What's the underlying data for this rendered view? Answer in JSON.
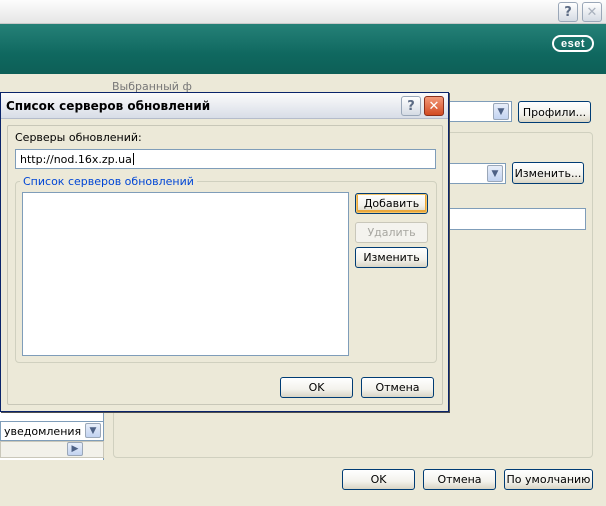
{
  "window": {
    "help_glyph": "?",
    "close_glyph": "✕",
    "brand_logo": "eset",
    "brand_color": "#13766c"
  },
  "background": {
    "partial_label": "Выбранный ф",
    "profiles_button": "Профили...",
    "change_button": "Изменить...",
    "notifications_value": "уведомления",
    "ok_button": "OK",
    "cancel_button": "Отмена",
    "defaults_button": "По умолчанию"
  },
  "dialog": {
    "title": "Список серверов обновлений",
    "help_glyph": "?",
    "close_glyph": "✕",
    "servers_label": "Серверы обновлений:",
    "server_input_value": "http://nod.16x.zp.ua",
    "group_title": "Список серверов обновлений",
    "list_items": [],
    "add_button": "Добавить",
    "delete_button": "Удалить",
    "edit_button": "Изменить",
    "ok_button": "OK",
    "cancel_button": "Отмена"
  }
}
